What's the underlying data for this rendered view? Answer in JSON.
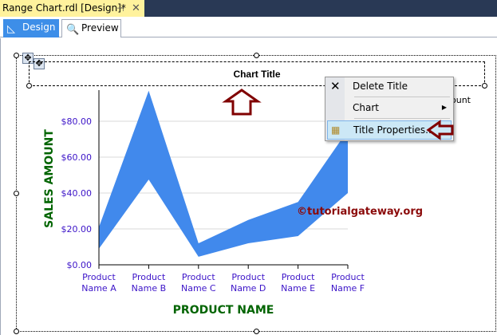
{
  "window": {
    "tab_title": "Range Chart.rdl [Design]*",
    "pin_icon": "pin-icon",
    "close_icon": "close-icon"
  },
  "view_tabs": [
    {
      "label": "Design",
      "active": true
    },
    {
      "label": "Preview",
      "active": false
    }
  ],
  "chart": {
    "title": "Chart Title",
    "legend_visible": "ount",
    "watermark": "©tutorialgateway.org"
  },
  "context_menu": {
    "items": [
      {
        "label": "Delete Title",
        "icon": "close-icon"
      },
      {
        "label": "Chart",
        "submenu": true
      },
      {
        "label": "Title Properties...",
        "icon": "properties-icon",
        "highlighted": true
      }
    ]
  },
  "colors": {
    "series": "#4189ec",
    "axis_label": "#006400",
    "tick_label": "#3c14c8",
    "annotation_arrow": "#800000"
  },
  "chart_data": {
    "type": "area",
    "subtype": "range",
    "title": "Chart Title",
    "xlabel": "PRODUCT NAME",
    "ylabel": "SALES AMOUNT",
    "categories": [
      "Product Name A",
      "Product Name B",
      "Product Name C",
      "Product Name D",
      "Product Name E",
      "Product Name F"
    ],
    "category_lines": [
      [
        "Product",
        "Name A"
      ],
      [
        "Product",
        "Name B"
      ],
      [
        "Product",
        "Name C"
      ],
      [
        "Product",
        "Name D"
      ],
      [
        "Product",
        "Name E"
      ],
      [
        "Product",
        "Name F"
      ]
    ],
    "low": [
      9,
      47.5,
      4.5,
      12,
      16,
      40
    ],
    "high": [
      21,
      97,
      12,
      25,
      35,
      75
    ],
    "yticks": [
      "$0.00",
      "$20.00",
      "$40.00",
      "$60.00",
      "$80.00"
    ],
    "ytick_values": [
      0,
      20,
      40,
      60,
      80
    ],
    "ylim": [
      0,
      100
    ],
    "grid": true
  }
}
